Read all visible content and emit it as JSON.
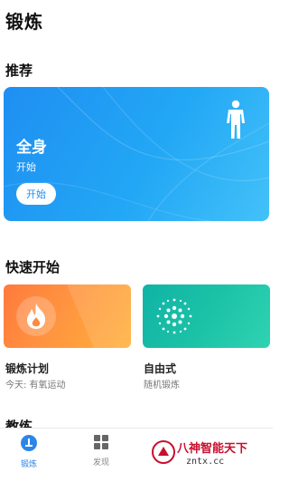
{
  "page": {
    "title": "锻炼"
  },
  "sections": {
    "recommend": "推荐",
    "quick_start": "快速开始",
    "coach": "教练"
  },
  "hero": {
    "title": "全身",
    "subtitle": "开始",
    "button_label": "开始",
    "gradient_colors": [
      "#1f8ff2",
      "#43c1f8"
    ],
    "icon": "standing-person-icon"
  },
  "quick_cards": [
    {
      "title": "锻炼计划",
      "subtitle": "今天: 有氧运动",
      "icon": "flame-icon",
      "color": "#ff8a3d"
    },
    {
      "title": "自由式",
      "subtitle": "随机锻炼",
      "icon": "dots-sphere-icon",
      "color": "#1cc2a6"
    }
  ],
  "bottom_nav": {
    "active_color": "#2b86e8",
    "tabs": [
      {
        "label": "锻炼",
        "icon": "workout-icon",
        "active": true
      },
      {
        "label": "发现",
        "icon": "grid-icon",
        "active": false
      }
    ]
  },
  "watermark": {
    "text": "八神智能天下",
    "url": "zntx.cc"
  }
}
